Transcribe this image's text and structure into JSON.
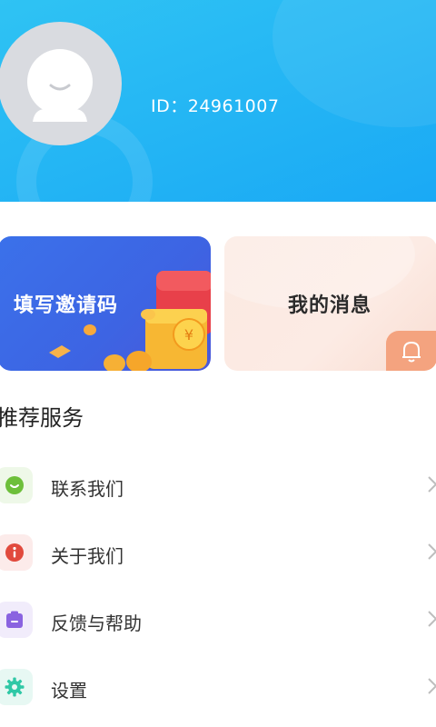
{
  "profile": {
    "user_id": "ID：24961007"
  },
  "cards": {
    "invite_label": "填写邀请码",
    "messages_label": "我的消息"
  },
  "section": {
    "title": "推荐服务"
  },
  "menu": [
    {
      "label": "联系我们",
      "icon": "chat-icon",
      "color": "#6dbf3a",
      "bg": "#eef8e8"
    },
    {
      "label": "关于我们",
      "icon": "info-icon",
      "color": "#e14a3d",
      "bg": "#fcebea"
    },
    {
      "label": "反馈与帮助",
      "icon": "feedback-icon",
      "color": "#8a63e0",
      "bg": "#f1ecfb"
    },
    {
      "label": "设置",
      "icon": "gear-icon",
      "color": "#2fc8a6",
      "bg": "#e7f8f3"
    }
  ],
  "colors": {
    "header": "#1fb2f4",
    "invite_card": "#3d69e6",
    "message_card": "#fbe9e1",
    "bell_badge": "#f4a37f"
  }
}
